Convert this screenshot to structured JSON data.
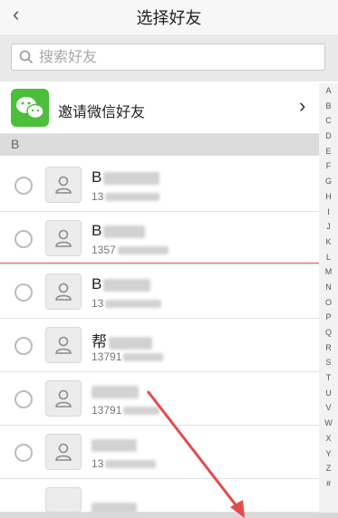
{
  "header": {
    "back_icon": "chevron-left-icon",
    "title": "选择好友"
  },
  "search": {
    "placeholder": "搜索好友",
    "icon": "search-icon"
  },
  "invite": {
    "label": "邀请微信好友",
    "logo": "wechat-logo",
    "chevron": "chevron-right-icon"
  },
  "section": {
    "letter": "B"
  },
  "contacts": [
    {
      "name_prefix": "B",
      "phone_prefix": "13",
      "selected": false
    },
    {
      "name_prefix": "B",
      "phone_prefix": "1357",
      "selected": false
    },
    {
      "name_prefix": "B",
      "phone_prefix": "13",
      "selected": false
    },
    {
      "name_prefix": "帮",
      "phone_prefix": "13791",
      "selected": false
    },
    {
      "name_prefix": "",
      "phone_prefix": "13791",
      "selected": false
    },
    {
      "name_prefix": "",
      "phone_prefix": "13",
      "selected": false
    }
  ],
  "index_letters": [
    "A",
    "B",
    "C",
    "D",
    "E",
    "F",
    "G",
    "H",
    "I",
    "J",
    "K",
    "L",
    "M",
    "N",
    "O",
    "P",
    "Q",
    "R",
    "S",
    "T",
    "U",
    "V",
    "W",
    "X",
    "Y",
    "Z",
    "#"
  ],
  "colors": {
    "accent_red": "#e34a4a",
    "wechat_green": "#4bbf3a"
  }
}
